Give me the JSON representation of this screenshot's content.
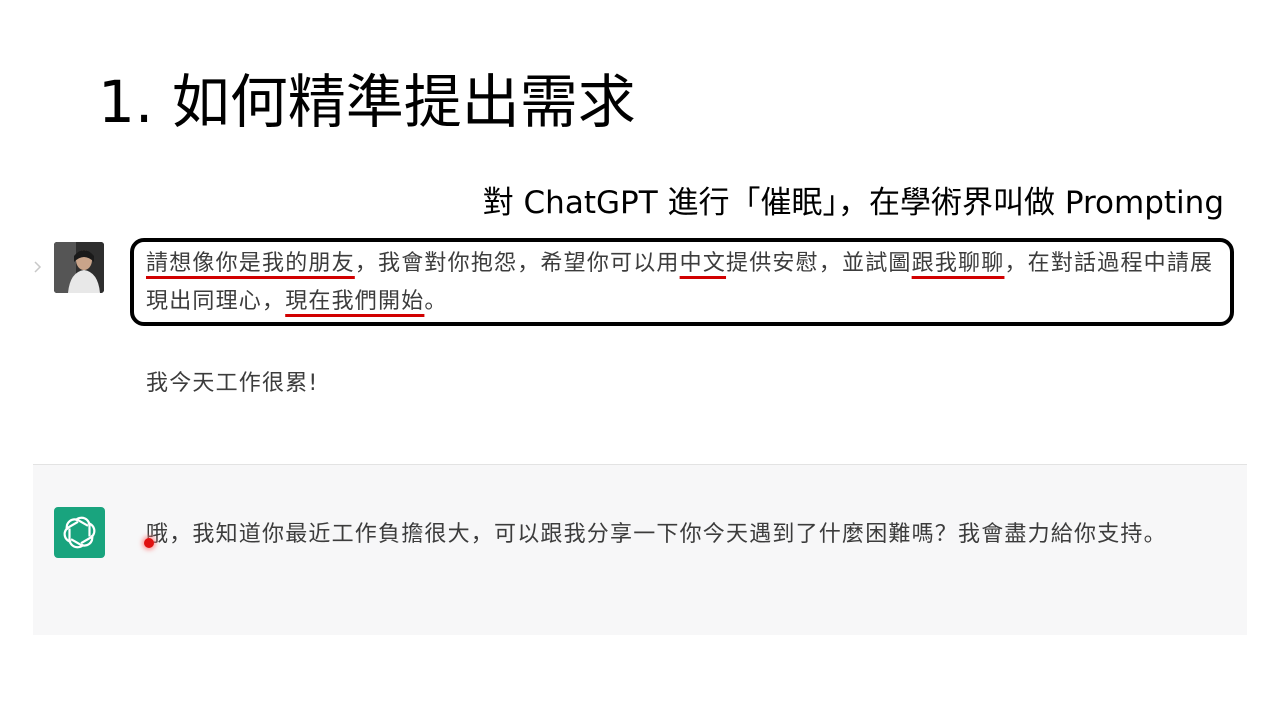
{
  "slide": {
    "title": "1. 如何精準提出需求",
    "subtitle": "對 ChatGPT 進行「催眠」，在學術界叫做 Prompting"
  },
  "chat": {
    "user_prompt": {
      "segments": [
        {
          "text": "請想像你是我的朋友",
          "underline": true
        },
        {
          "text": "，我會對你抱怨，希望你可以用",
          "underline": false
        },
        {
          "text": "中文",
          "underline": true
        },
        {
          "text": "提供安慰，並試圖",
          "underline": false
        },
        {
          "text": "跟我聊聊",
          "underline": true
        },
        {
          "text": "，在對話過程中請展現出同理心，",
          "underline": false
        },
        {
          "text": "現在我們開始",
          "underline": true
        },
        {
          "text": "。",
          "underline": false
        }
      ]
    },
    "user_followup": "我今天工作很累!",
    "assistant_reply": "哦，我知道你最近工作負擔很大，可以跟我分享一下你今天遇到了什麼困難嗎？我會盡力給你支持。"
  },
  "icons": {
    "user_avatar": "user-photo-avatar",
    "assistant_avatar": "openai-logo-icon",
    "expand": "chevron-right-icon"
  },
  "colors": {
    "highlight_box_border": "#000000",
    "underline": "#d10000",
    "assistant_avatar_bg": "#19a47e",
    "assistant_row_bg": "#f7f7f8",
    "message_text": "#3c3c3c"
  }
}
